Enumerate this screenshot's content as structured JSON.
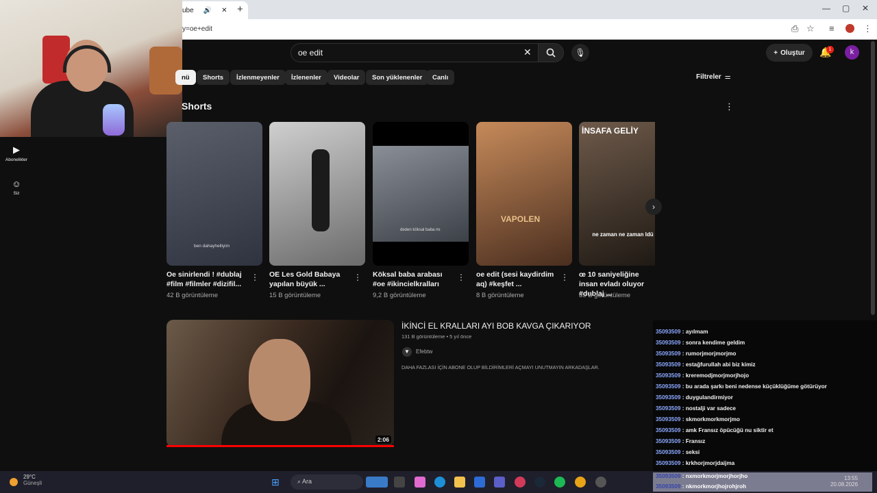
{
  "browser": {
    "tab_title": "ube",
    "url": "y=oe+edit",
    "new_tab": "+",
    "minimize": "—",
    "maximize": "▢",
    "close": "✕"
  },
  "search": {
    "query": "oe edit",
    "clear": "✕"
  },
  "header": {
    "create_label": "Oluştur",
    "create_plus": "+",
    "notifications": "1",
    "avatar": "k"
  },
  "chips": [
    "nü",
    "Shorts",
    "İzlenmeyenler",
    "İzlenenler",
    "Videolar",
    "Son yüklenenler",
    "Canlı"
  ],
  "filters_label": "Filtreler",
  "sidebar": [
    {
      "label": "Abonelikler"
    },
    {
      "label": "Siz"
    }
  ],
  "shorts_section": {
    "title": "Shorts",
    "items": [
      {
        "title": "Oe sinirlendi ! #dublaj #film #filmler #dizifil...",
        "views": "42 B görüntüleme",
        "caption": "ben dahayhelliyim",
        "colors": [
          "#5b5f6a",
          "#2f3340"
        ]
      },
      {
        "title": "OE Les Gold Babaya yapılan büyük ...",
        "views": "15 B görüntüleme",
        "caption": "",
        "colors": [
          "#cfcfcf",
          "#6b6b6b"
        ]
      },
      {
        "title": "Köksal baba arabası #oe #ikincielkralları",
        "views": "9,2 B görüntüleme",
        "caption": "deden köksal baba mı",
        "colors": [
          "#8a8f97",
          "#3c4148"
        ]
      },
      {
        "title": "oe edit (sesi kaydirdim aq) #keşfet ...",
        "views": "8 B görüntüleme",
        "caption": "VAPOLEN",
        "colors": [
          "#c68a5a",
          "#4a2e1f"
        ]
      },
      {
        "title": "œ 10 saniyeliğine insan evladı oluyor #dublaj ...",
        "views": "35 B görüntüleme",
        "caption": "İNSAFA GELİY",
        "caption2": "ne zaman ne zaman ldü",
        "colors": [
          "#6e5a4a",
          "#1c1712"
        ]
      }
    ]
  },
  "video": {
    "title": "İKİNCİ EL KRALLARI AYI BOB KAVGA ÇIKARIYOR",
    "meta": "131 B görüntüleme • 5 yıl önce",
    "channel": "Efebtw",
    "description": "DAHA FAZLASI İÇİN ABONE OLUP BİLDİRİMLERİ AÇMAYI UNUTMAYIN ARKADAŞLAR.",
    "duration": "2:06"
  },
  "chat": [
    {
      "user": "35093509",
      "text": "ayılmam"
    },
    {
      "user": "35093509",
      "text": "sonra kendime geldim"
    },
    {
      "user": "35093509",
      "text": "rumorjmorjmorjmo"
    },
    {
      "user": "35093509",
      "text": "estağfurullah abi biz kimiz"
    },
    {
      "user": "35093509",
      "text": "kreremodjmorjmorjhojo"
    },
    {
      "user": "35093509",
      "text": "bu arada şarkı beni nedense küçüklüğüme götürüyor"
    },
    {
      "user": "35093509",
      "text": "duygulandirmiyor"
    },
    {
      "user": "35093509",
      "text": "nostalji var sadece"
    },
    {
      "user": "35093509",
      "text": "skmorkmorkmorjmo"
    },
    {
      "user": "35093509",
      "text": "amk Fransız öpücüğü nu siktir et"
    },
    {
      "user": "35093509",
      "text": "Fransız"
    },
    {
      "user": "35093509",
      "text": "seksi"
    },
    {
      "user": "35093509",
      "text": "krkhorjmorjdaijma"
    },
    {
      "user": "35093509",
      "text": "nxmorkmorjmorjhorjho"
    },
    {
      "user": "35093509",
      "text": "nkmorkmorjhojrohjroh"
    }
  ],
  "taskbar": {
    "temp": "29°C",
    "weather": "Güneşli",
    "search": "Ara",
    "time": "13:55",
    "date": "20.08.2026"
  }
}
